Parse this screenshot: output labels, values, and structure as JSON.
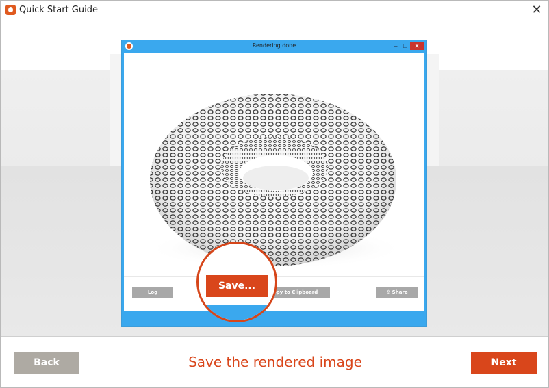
{
  "window": {
    "title": "Quick Start Guide",
    "close_glyph": "✕"
  },
  "render_window": {
    "title": "Rendering done",
    "buttons": {
      "log": "Log",
      "save": "Save...",
      "copy": "Copy to Clipboard",
      "share": "Share"
    }
  },
  "footer": {
    "back_label": "Back",
    "caption": "Save the rendered image",
    "next_label": "Next"
  },
  "colors": {
    "accent": "#d9461b",
    "window_blue": "#3aa8ee",
    "muted_button": "#aeaaa3"
  },
  "icons": {
    "app_logo": "keyshot-logo-icon",
    "share": "share-icon",
    "close": "close-icon"
  }
}
